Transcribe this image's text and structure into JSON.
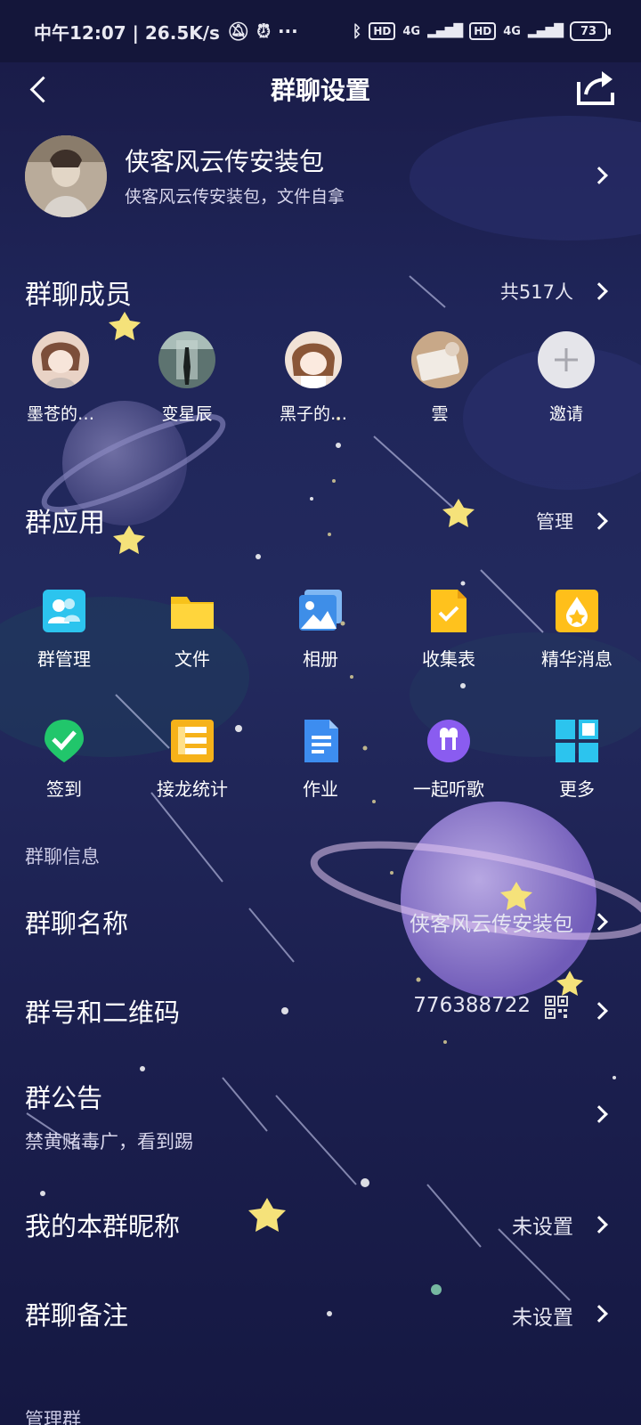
{
  "status_bar": {
    "left": "中午12:07 | 26.5K/s",
    "hd1": "HD",
    "net1": "4G",
    "hd2": "HD",
    "net2": "4G",
    "battery": "73"
  },
  "header": {
    "title": "群聊设置"
  },
  "group": {
    "name": "侠客风云传安装包",
    "description": "侠客风云传安装包，文件自拿"
  },
  "members": {
    "title": "群聊成员",
    "count": "共517人",
    "items": [
      {
        "name": "墨苍的…"
      },
      {
        "name": "变星辰"
      },
      {
        "name": "黑子的…"
      },
      {
        "name": "雲"
      },
      {
        "name": "邀请"
      }
    ]
  },
  "apps": {
    "title": "群应用",
    "manage": "管理",
    "items": [
      {
        "label": "群管理",
        "icon": "group-manage-icon"
      },
      {
        "label": "文件",
        "icon": "folder-icon"
      },
      {
        "label": "相册",
        "icon": "album-icon"
      },
      {
        "label": "收集表",
        "icon": "collect-form-icon"
      },
      {
        "label": "精华消息",
        "icon": "essence-icon"
      },
      {
        "label": "签到",
        "icon": "checkin-icon"
      },
      {
        "label": "接龙统计",
        "icon": "relay-stats-icon"
      },
      {
        "label": "作业",
        "icon": "homework-icon"
      },
      {
        "label": "一起听歌",
        "icon": "listen-together-icon"
      },
      {
        "label": "更多",
        "icon": "more-grid-icon"
      }
    ]
  },
  "info": {
    "section_title": "群聊信息",
    "name_label": "群聊名称",
    "name_value": "侠客风云传安装包",
    "id_label": "群号和二维码",
    "id_value": "776388722",
    "notice_label": "群公告",
    "notice_text": "禁黄赌毒广，看到踢",
    "nickname_label": "我的本群昵称",
    "nickname_value": "未设置",
    "remark_label": "群聊备注",
    "remark_value": "未设置"
  },
  "manage": {
    "section_title": "管理群"
  },
  "colors": {
    "background": "#1f2559",
    "statusbar": "#14163a",
    "star": "#f5e27a",
    "planet": "#9c84d8"
  }
}
